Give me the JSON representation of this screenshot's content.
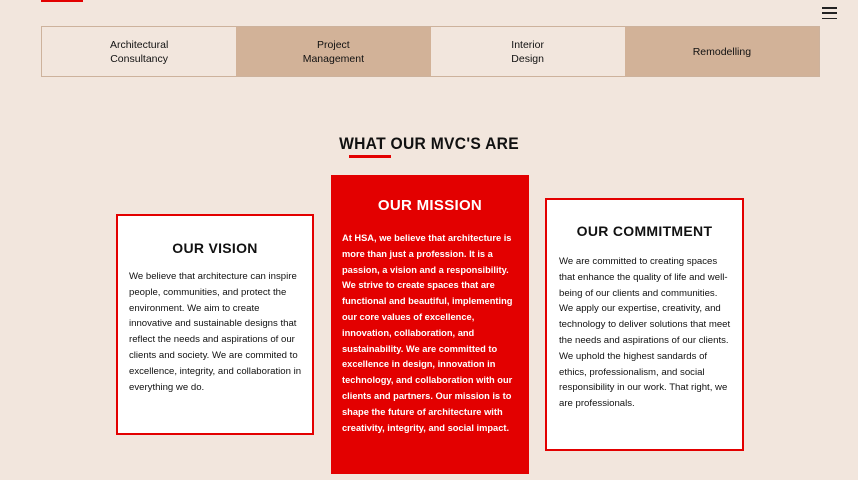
{
  "nav": {
    "menu_icon": "hamburger-menu-icon"
  },
  "tabs": [
    {
      "label": "Architectural\nConsultancy"
    },
    {
      "label": "Project\nManagement"
    },
    {
      "label": "Interior\nDesign"
    },
    {
      "label": "Remodelling"
    }
  ],
  "section": {
    "heading": "WHAT OUR MVC'S ARE"
  },
  "cards": {
    "vision": {
      "title": "OUR VISION",
      "body": "We believe that architecture can inspire people, communities, and protect the environment. We aim to create innovative and sustainable designs that reflect the needs and aspirations of our clients and society. We are commited to excellence, integrity, and collaboration in everything we do."
    },
    "mission": {
      "title": "OUR MISSION",
      "body": "At HSA, we believe that architecture is more than just a profession. It is a passion, a vision and a responsibility. We strive to create spaces that are functional and beautiful, implementing our core values of excellence, innovation, collaboration, and sustainability. We are committed to excellence in design, innovation in technology, and collaboration with our clients and partners. Our mission is to shape the future of architecture with creativity, integrity, and social impact."
    },
    "commitment": {
      "title": "OUR COMMITMENT",
      "body": "We are committed to creating spaces that enhance the quality of life and well-being of our clients and communities. We apply our expertise, creativity, and technology to deliver solutions that meet the needs and aspirations of our clients. We uphold the highest sandards of ethics, professionalism, and social responsibility in our work. That right, we are professionals."
    }
  },
  "colors": {
    "accent": "#e30000",
    "background": "#f2e6dd",
    "tab_tan": "#d2b298"
  }
}
